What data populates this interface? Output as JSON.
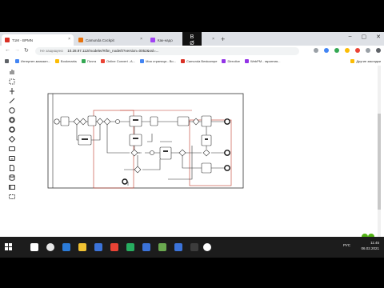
{
  "browser": {
    "tabs": [
      {
        "label": "T1M - BPMN",
        "color": "#d93025",
        "active": true
      },
      {
        "label": "Camunda Cockpit",
        "color": "#e8710a",
        "active": false
      },
      {
        "label": "Как-надо",
        "color": "#a142f4",
        "active": false
      }
    ],
    "overlay_logo": "BØ\nO",
    "address": {
      "security": "Не защищено",
      "url": "10.28.97.112/modeler/#/bn_node/0?version=0052&ssl=..."
    },
    "bookmarks": [
      {
        "label": "Интернет-магазин...",
        "color": "#4285f4"
      },
      {
        "label": "Bookmarks",
        "color": "#fbbc04"
      },
      {
        "label": "Почта",
        "color": "#34a853"
      },
      {
        "label": "Online Convert - A...",
        "color": "#ea4335"
      },
      {
        "label": "Моя страница - Во...",
        "color": "#4285f4"
      },
      {
        "label": "Camunda Bestcampe",
        "color": "#d93025"
      },
      {
        "label": "Directive",
        "color": "#9334e6"
      },
      {
        "label": "WebPM - гарантия...",
        "color": "#9334e6"
      }
    ],
    "bookmarks_other": "Другие закладки"
  },
  "palette": {
    "tools": [
      "hand-tool",
      "lasso-tool",
      "space-tool",
      "connect-tool",
      "start-event",
      "intermediate-event",
      "end-event",
      "gateway",
      "task",
      "subprocess",
      "data-object",
      "data-store",
      "pool",
      "group"
    ]
  },
  "taskbar": {
    "lang": "РУС",
    "time": "11:45",
    "date": "06.02.2021",
    "apps": [
      "#ffffff",
      "#e8e8e8",
      "#2b7bd8",
      "#f1c232",
      "#3b73d9",
      "#ea4335",
      "#27ae60",
      "#3b73d9",
      "#6aa84f",
      "#3b73d9",
      "#3c3c3c",
      "#ffffff"
    ]
  }
}
